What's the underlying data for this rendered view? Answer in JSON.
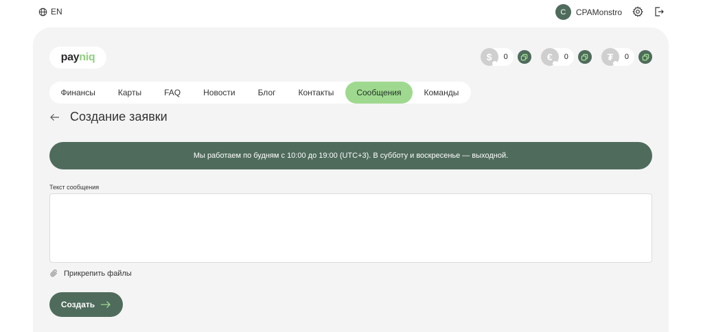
{
  "topbar": {
    "language": "EN",
    "username": "CPAMonstro",
    "avatar_letter": "C"
  },
  "logo": {
    "part1": "pay",
    "part2": "niq"
  },
  "balances": [
    {
      "currency_symbol": "$",
      "value": "0",
      "icon": "dollar-coin-icon"
    },
    {
      "currency_symbol": "€",
      "value": "0",
      "icon": "euro-coin-icon"
    },
    {
      "currency_symbol": "₮",
      "value": "0",
      "icon": "tether-coin-icon"
    }
  ],
  "nav": {
    "items": [
      "Финансы",
      "Карты",
      "FAQ",
      "Новости",
      "Блог",
      "Контакты",
      "Сообщения",
      "Команды"
    ],
    "active_index": 6
  },
  "page": {
    "title": "Создание заявки",
    "banner": "Мы работаем по будням с 10:00 до 19:00 (UTC+3). В субботу и воскресенье — выходной.",
    "message_label": "Текст сообщения",
    "message_value": "",
    "attach_label": "Прикрепить файлы",
    "submit_label": "Создать"
  },
  "colors": {
    "accent_dark": "#4f6b5c",
    "accent_light": "#9fd98f",
    "card_bg": "#f4f4f4"
  }
}
